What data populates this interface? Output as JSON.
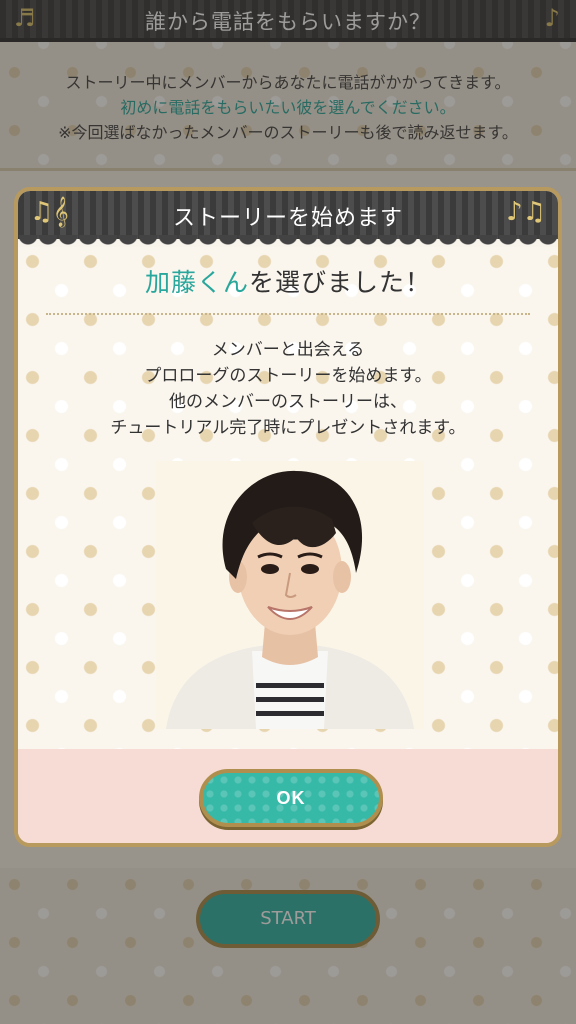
{
  "background": {
    "title": "誰から電話をもらいますか？",
    "intro_line1": "ストーリー中にメンバーからあなたに電話がかかってきます。",
    "intro_line2": "初めに電話をもらいたい彼を選んでください。",
    "intro_line3": "※今回選ばなかったメンバーのストーリーも後で読み返せます。",
    "start_label": "START"
  },
  "dialog": {
    "title": "ストーリーを始めます",
    "selected_name": "加藤くん",
    "selected_suffix": "を選びました！",
    "desc_line1": "メンバーと出会える",
    "desc_line2": "プロローグのストーリーを始めます。",
    "desc_line3": "他のメンバーのストーリーは、",
    "desc_line4": "チュートリアル完了時にプレゼントされます。",
    "ok_label": "OK"
  },
  "icons": {
    "left": "music-notes-icon",
    "right": "music-notes-icon"
  },
  "colors": {
    "accent": "#2aa79c",
    "button": "#37b9a8",
    "gold": "#b08f4e",
    "header": "#3b3b3b",
    "footer": "#f6dcd4"
  }
}
